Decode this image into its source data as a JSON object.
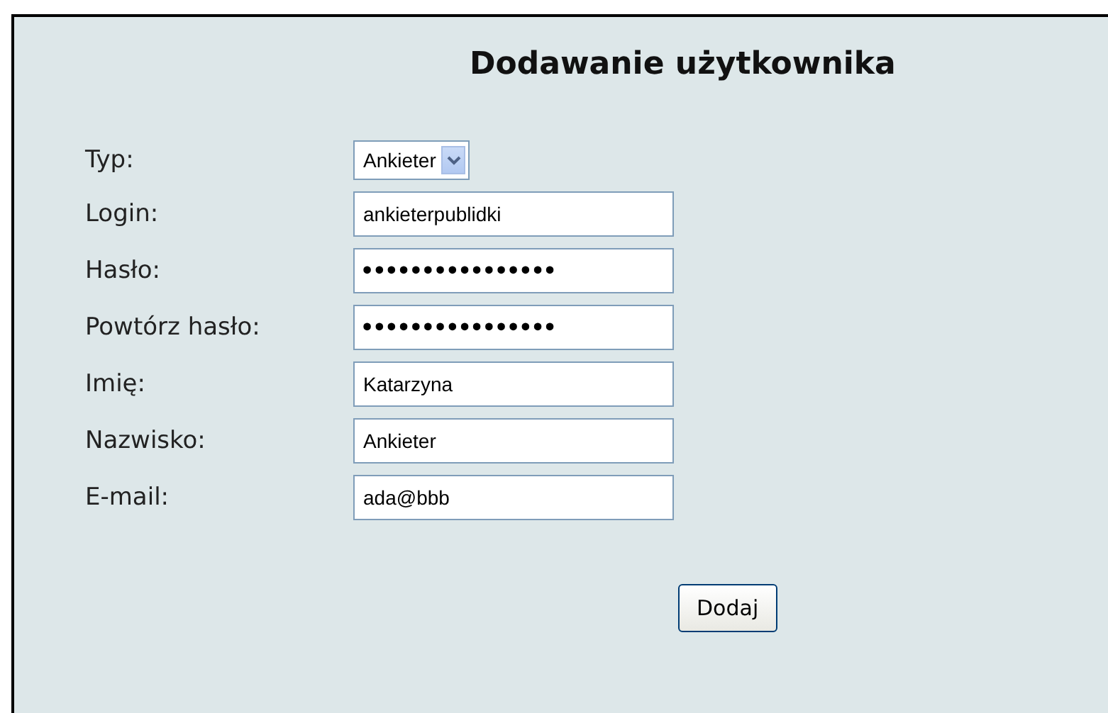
{
  "form": {
    "title": "Dodawanie użytkownika",
    "fields": [
      {
        "label": "Typ:",
        "kind": "select",
        "value": "Ankieter"
      },
      {
        "label": "Login:",
        "kind": "text",
        "value": "ankieterpublidki"
      },
      {
        "label": "Hasło:",
        "kind": "password",
        "value": "••••••••••••••••"
      },
      {
        "label": "Powtórz hasło:",
        "kind": "password",
        "value": "••••••••••••••••"
      },
      {
        "label": "Imię:",
        "kind": "text",
        "value": "Katarzyna"
      },
      {
        "label": "Nazwisko:",
        "kind": "text",
        "value": "Ankieter"
      },
      {
        "label": "E-mail:",
        "kind": "text",
        "value": "ada@bbb"
      }
    ],
    "submit": "Dodaj"
  }
}
